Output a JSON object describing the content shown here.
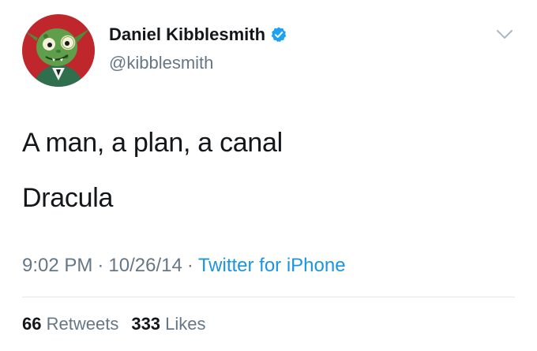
{
  "author": {
    "display_name": "Daniel Kibblesmith",
    "handle": "@kibblesmith",
    "verified": true
  },
  "tweet": {
    "lines": [
      "A man, a plan, a canal",
      "Dracula"
    ]
  },
  "meta": {
    "time": "9:02 PM",
    "separator": "·",
    "date": "10/26/14",
    "source": "Twitter for iPhone"
  },
  "stats": {
    "retweets_count": "66",
    "retweets_label": "Retweets",
    "likes_count": "333",
    "likes_label": "Likes"
  },
  "colors": {
    "verified_blue": "#1da1f2",
    "link_blue": "#1b95e0",
    "secondary_text": "#657786",
    "avatar_bg": "#c0272d"
  },
  "icons": {
    "verified": "verified-badge-icon",
    "menu": "chevron-down-icon"
  }
}
